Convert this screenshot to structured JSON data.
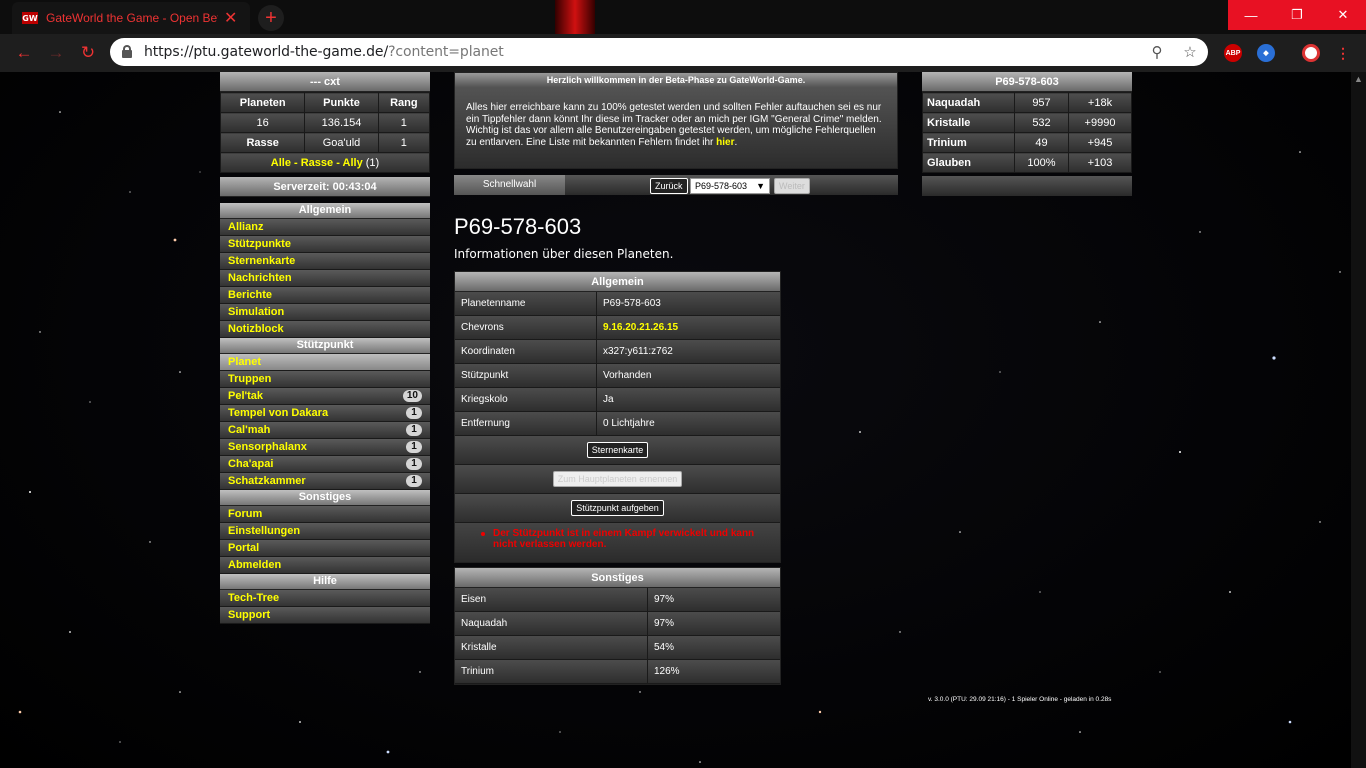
{
  "browser": {
    "tab_title": "GateWorld the Game - Open Beta",
    "favicon": "GW",
    "url_host": "https://ptu.gateworld-the-game.de/",
    "url_path": "?content=planet",
    "accent": "#e81123"
  },
  "player": {
    "name": "--- cxt",
    "headers": [
      "Planeten",
      "Punkte",
      "Rang"
    ],
    "values": [
      "16",
      "136.154",
      "1"
    ],
    "race_label": "Rasse",
    "race": "Goa'uld",
    "race_rank": "1",
    "chat_links": "Alle - Rasse - Ally",
    "chat_count": "(1)"
  },
  "server_time": "Serverzeit: 00:43:04",
  "menu": {
    "sections": [
      {
        "title": "Allgemein",
        "items": [
          {
            "label": "Allianz"
          },
          {
            "label": "Stützpunkte"
          },
          {
            "label": "Sternenkarte"
          },
          {
            "label": "Nachrichten"
          },
          {
            "label": "Berichte"
          },
          {
            "label": "Simulation"
          },
          {
            "label": "Notizblock"
          }
        ]
      },
      {
        "title": "Stützpunkt",
        "items": [
          {
            "label": "Planet",
            "badge": ""
          },
          {
            "label": "Truppen",
            "badge": ""
          },
          {
            "label": "Pel'tak",
            "badge": "10"
          },
          {
            "label": "Tempel von Dakara",
            "badge": "1"
          },
          {
            "label": "Cal'mah",
            "badge": "1"
          },
          {
            "label": "Sensorphalanx",
            "badge": "1"
          },
          {
            "label": "Cha'apai",
            "badge": "1"
          },
          {
            "label": "Schatzkammer",
            "badge": "1"
          }
        ]
      },
      {
        "title": "Sonstiges",
        "items": [
          {
            "label": "Forum"
          },
          {
            "label": "Einstellungen"
          },
          {
            "label": "Portal"
          },
          {
            "label": "Abmelden"
          }
        ]
      },
      {
        "title": "Hilfe",
        "items": [
          {
            "label": "Tech-Tree"
          },
          {
            "label": "Support"
          }
        ]
      }
    ]
  },
  "welcome": {
    "title": "Herzlich willkommen in der Beta-Phase zu GateWorld-Game.",
    "text": "Alles hier erreichbare kann zu 100% getestet werden und sollten Fehler auftauchen sei es nur ein Tippfehler dann könnt Ihr diese im Tracker oder an mich per IGM \"General Crime\" melden. Wichtig ist das vor allem alle Benutzereingaben getestet werden, um mögliche Fehlerquellen zu entlarven. Eine Liste mit bekannten Fehlern findet ihr",
    "link": "hier",
    "after_link": "."
  },
  "quickselect": {
    "label": "Schnellwahl",
    "back": "Zurück",
    "selected": "P69-578-603",
    "next": "Weiter"
  },
  "planet": {
    "title": "P69-578-603",
    "subtitle": "Informationen über diesen Planeten.",
    "general_title": "Allgemein",
    "rows": [
      {
        "key": "Planetenname",
        "value": "P69-578-603"
      },
      {
        "key": "Chevrons",
        "value": "9.16.20.21.26.15"
      },
      {
        "key": "Koordinaten",
        "value": "x327:y611:z762"
      },
      {
        "key": "Stützpunkt",
        "value": "Vorhanden"
      },
      {
        "key": "Kriegskolo",
        "value": "Ja"
      },
      {
        "key": "Entfernung",
        "value": "0 Lichtjahre"
      }
    ],
    "btn_starmap": "Sternenkarte",
    "btn_main": "Zum Hauptplaneten ernennen",
    "btn_abandon": "Stützpunkt aufgeben",
    "warning": "Der Stützpunkt ist in einem Kampf verwickelt und kann nicht verlassen werden.",
    "misc_title": "Sonstiges",
    "misc_rows": [
      {
        "key": "Eisen",
        "value": "97%"
      },
      {
        "key": "Naquadah",
        "value": "97%"
      },
      {
        "key": "Kristalle",
        "value": "54%"
      },
      {
        "key": "Trinium",
        "value": "126%"
      }
    ]
  },
  "resources": {
    "title": "P69-578-603",
    "rows": [
      {
        "name": "Naquadah",
        "amount": "957",
        "rate": "+18k"
      },
      {
        "name": "Kristalle",
        "amount": "532",
        "rate": "+9990"
      },
      {
        "name": "Trinium",
        "amount": "49",
        "rate": "+945"
      },
      {
        "name": "Glauben",
        "amount": "100%",
        "rate": "+103"
      }
    ]
  },
  "footer": "v. 3.0.0 (PTU: 29.09 21:16) - 1 Spieler Online - geladen in 0.28s"
}
